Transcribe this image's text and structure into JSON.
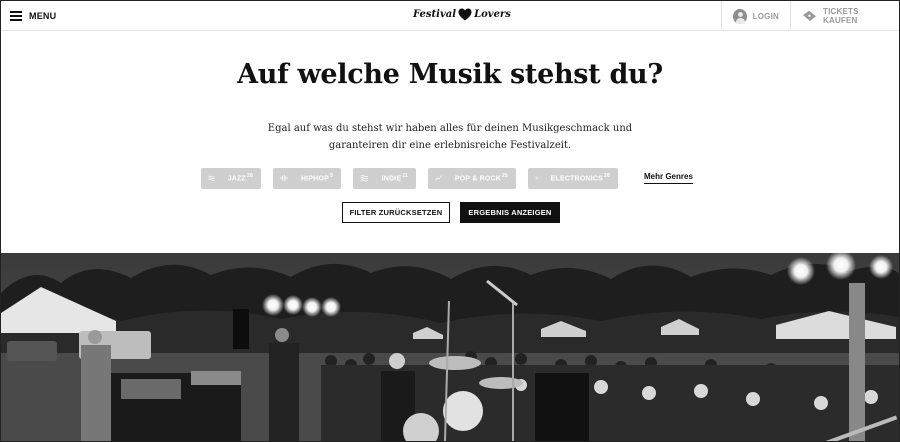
{
  "header": {
    "menu_label": "MENU",
    "logo_left": "Festival",
    "logo_right": "Lovers",
    "login_label": "LOGIN",
    "tickets_label": "TICKETS KAUFEN"
  },
  "hero": {
    "title": "Auf welche Musik stehst du?",
    "description": "Egal auf was du stehst wir haben alles für deinen Musikgeschmack und garanteiren dir eine erlebnisreiche Festivalzeit."
  },
  "genres": [
    {
      "label": "JAZZ",
      "count": "28",
      "icon": "waves-icon"
    },
    {
      "label": "HIPHOP",
      "count": "9",
      "icon": "sound-bars-icon"
    },
    {
      "label": "INDIE",
      "count": "11",
      "icon": "waves-icon"
    },
    {
      "label": "POP & ROCK",
      "count": "25",
      "icon": "trend-line-icon"
    },
    {
      "label": "ELECTRONICS",
      "count": "28",
      "icon": "equalizer-icon"
    }
  ],
  "more_genres": "Mehr Genres",
  "actions": {
    "reset_label": "FILTER ZURÜCKSETZEN",
    "show_label": "ERGEBNIS ANZEIGEN"
  },
  "colors": {
    "chip_bg": "#cfcfcf",
    "primary": "#111111",
    "muted_text": "#9a9a9a"
  }
}
